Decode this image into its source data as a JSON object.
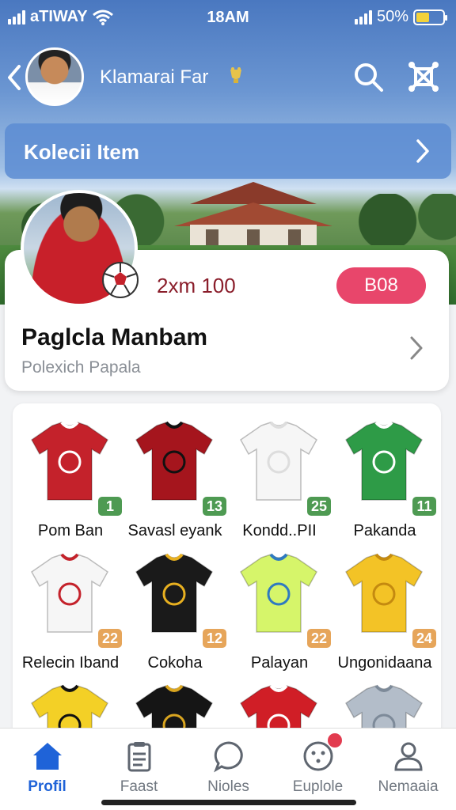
{
  "status_bar": {
    "carrier": "aTIWAY",
    "time": "18AM",
    "battery_percent": "50%",
    "battery_level": 0.5
  },
  "header": {
    "profile_name": "Klamarai Far",
    "icons": [
      "back-arrow-icon",
      "search-icon",
      "network-icon"
    ]
  },
  "collection_bar": {
    "label": "Kolecii Item"
  },
  "profile_card": {
    "stat": "2xm 100",
    "action_button": "B08",
    "title": "Paglcla Manbam",
    "subtitle": "Polexich Papala"
  },
  "items": [
    {
      "label": "Pom Ban",
      "badge": "1",
      "badge_color": "#4e9a52",
      "shirt": "#c4222b",
      "trim": "#ffffff"
    },
    {
      "label": "Savasl eyank",
      "badge": "13",
      "badge_color": "#4e9a52",
      "shirt": "#a5151d",
      "trim": "#111111"
    },
    {
      "label": "Kondd..PII",
      "badge": "25",
      "badge_color": "#4e9a52",
      "shirt": "#f6f6f6",
      "trim": "#dddddd"
    },
    {
      "label": "Pakanda",
      "badge": "11",
      "badge_color": "#4e9a52",
      "shirt": "#2e9b47",
      "trim": "#ffffff"
    },
    {
      "label": "Relecin Iband",
      "badge": "22",
      "badge_color": "#e6a55a",
      "shirt": "#f6f6f6",
      "trim": "#c4222b"
    },
    {
      "label": "Cokoha",
      "badge": "12",
      "badge_color": "#e6a55a",
      "shirt": "#1a1a1a",
      "trim": "#e8b020"
    },
    {
      "label": "Palayan",
      "badge": "22",
      "badge_color": "#e6a55a",
      "shirt": "#d6f56a",
      "trim": "#2f7ac0"
    },
    {
      "label": "Ungonidaana",
      "badge": "24",
      "badge_color": "#e6a55a",
      "shirt": "#f3c326",
      "trim": "#c48a10"
    },
    {
      "label": "",
      "badge": "",
      "badge_color": "#e6a55a",
      "shirt": "#f3d026",
      "trim": "#111111"
    },
    {
      "label": "",
      "badge": "",
      "badge_color": "#e6a55a",
      "shirt": "#151515",
      "trim": "#d9a520"
    },
    {
      "label": "",
      "badge": "",
      "badge_color": "#e6a55a",
      "shirt": "#d01e26",
      "trim": "#ffffff"
    },
    {
      "label": "",
      "badge": "",
      "badge_color": "#e6a55a",
      "shirt": "#b3bdc9",
      "trim": "#7d8a99"
    }
  ],
  "bottom_nav": [
    {
      "label": "Profil",
      "icon": "home-icon",
      "active": true
    },
    {
      "label": "Faast",
      "icon": "clipboard-icon",
      "active": false
    },
    {
      "label": "Nioles",
      "icon": "chat-bubble-icon",
      "active": false
    },
    {
      "label": "Euplole",
      "icon": "explore-icon",
      "active": false
    },
    {
      "label": "Nemaaia",
      "icon": "user-icon",
      "active": false
    }
  ],
  "colors": {
    "accent": "#1f63d8",
    "pill": "#e8466b",
    "stat_text": "#8a1d2a"
  }
}
